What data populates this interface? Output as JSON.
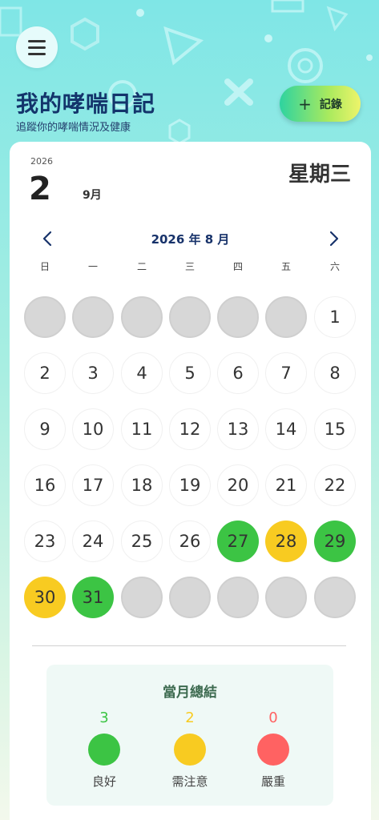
{
  "header": {
    "title": "我的哮喘日記",
    "subtitle": "追蹤你的哮喘情況及健康",
    "record_plus": "+",
    "record_label": "記錄"
  },
  "today": {
    "year": "2026",
    "day": "2",
    "month": "9月",
    "weekday": "星期三"
  },
  "calendar": {
    "month_label": "2026 年 8 月",
    "weekdays": [
      "日",
      "一",
      "二",
      "三",
      "四",
      "五",
      "六"
    ],
    "leading_empty": 6,
    "days": [
      {
        "d": "1",
        "status": "none"
      },
      {
        "d": "2",
        "status": "none"
      },
      {
        "d": "3",
        "status": "none"
      },
      {
        "d": "4",
        "status": "none"
      },
      {
        "d": "5",
        "status": "none"
      },
      {
        "d": "6",
        "status": "none"
      },
      {
        "d": "7",
        "status": "none"
      },
      {
        "d": "8",
        "status": "none"
      },
      {
        "d": "9",
        "status": "none"
      },
      {
        "d": "10",
        "status": "none"
      },
      {
        "d": "11",
        "status": "none"
      },
      {
        "d": "12",
        "status": "none"
      },
      {
        "d": "13",
        "status": "none"
      },
      {
        "d": "14",
        "status": "none"
      },
      {
        "d": "15",
        "status": "none"
      },
      {
        "d": "16",
        "status": "none"
      },
      {
        "d": "17",
        "status": "none"
      },
      {
        "d": "18",
        "status": "none"
      },
      {
        "d": "19",
        "status": "none"
      },
      {
        "d": "20",
        "status": "none"
      },
      {
        "d": "21",
        "status": "none"
      },
      {
        "d": "22",
        "status": "none"
      },
      {
        "d": "23",
        "status": "none"
      },
      {
        "d": "24",
        "status": "none"
      },
      {
        "d": "25",
        "status": "none"
      },
      {
        "d": "26",
        "status": "none"
      },
      {
        "d": "27",
        "status": "good"
      },
      {
        "d": "28",
        "status": "warn"
      },
      {
        "d": "29",
        "status": "good"
      },
      {
        "d": "30",
        "status": "warn"
      },
      {
        "d": "31",
        "status": "good"
      }
    ],
    "trailing_empty": 5
  },
  "summary": {
    "title": "當月總結",
    "items": [
      {
        "count": "3",
        "label": "良好",
        "color": "#3cc444"
      },
      {
        "count": "2",
        "label": "需注意",
        "color": "#f8cb21"
      },
      {
        "count": "0",
        "label": "嚴重",
        "color": "#ff6262"
      }
    ]
  },
  "colors": {
    "good": "#3cc444",
    "warn": "#f8cb21",
    "severe": "#ff6262",
    "accent": "#13346b"
  }
}
